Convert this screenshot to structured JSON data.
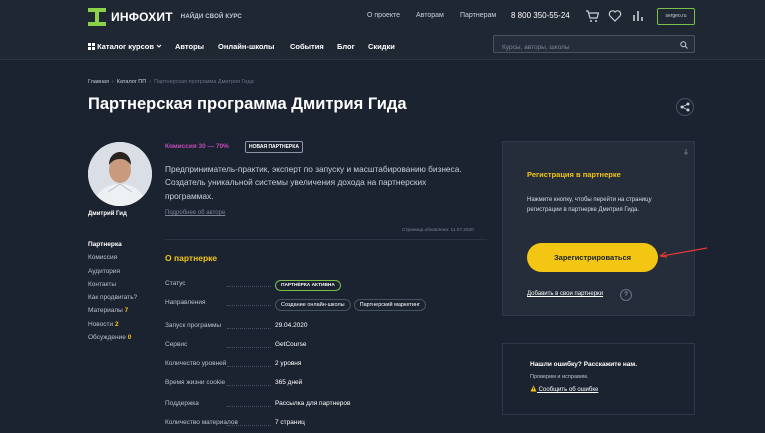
{
  "header": {
    "brand": "ИНФОХИТ",
    "tagline": "НАЙДИ СВОЙ КУРС",
    "links": [
      "О проекте",
      "Авторам",
      "Партнерам"
    ],
    "phone": "8 800 350-55-24",
    "account": "sergeo.ru"
  },
  "nav": {
    "catalog": "Каталог курсов",
    "items": [
      "Авторы",
      "Онлайн-школы",
      "События",
      "Блог",
      "Скидки"
    ],
    "search_placeholder": "Курсы, авторы, школы"
  },
  "breadcrumbs": [
    "Главная",
    "Каталог ПП",
    "Партнерская программа Дмитрия Гида"
  ],
  "page_title": "Партнерская программа Дмитрия Гида",
  "author": {
    "name": "Дмитрий Гид",
    "commission": "Комиссия 30 — 70%",
    "badge": "НОВАЯ ПАРТНЕРКА",
    "description": "Предприниматель-практик, эксперт по запуску и масштабированию бизнеса. Создатель уникальной системы увеличения дохода на партнерских программах.",
    "more_link": "Подробнее об авторе",
    "updated": "Страница обновлена: 11.07.2020"
  },
  "sidebar": {
    "items": [
      {
        "label": "Партнерка",
        "count": ""
      },
      {
        "label": "Комиссия",
        "count": ""
      },
      {
        "label": "Аудитория",
        "count": ""
      },
      {
        "label": "Контакты",
        "count": ""
      },
      {
        "label": "Как продвигать?",
        "count": ""
      },
      {
        "label": "Материалы",
        "count": "7"
      },
      {
        "label": "Новости",
        "count": "2"
      },
      {
        "label": "Обсуждение",
        "count": "0"
      }
    ]
  },
  "about": {
    "title": "О партнерке",
    "rows": [
      {
        "key": "Статус",
        "value": "ПАРТНЁРКА АКТИВНА"
      },
      {
        "key": "Направления",
        "value": ""
      },
      {
        "key": "Запуск программы",
        "value": "29.04.2020"
      },
      {
        "key": "Сервис",
        "value": "GetCourse"
      },
      {
        "key": "Количество уровней",
        "value": "2 уровня"
      },
      {
        "key": "Время жизни cookie",
        "value": "365 дней"
      },
      {
        "key": "Поддержка",
        "value": "Рассылка для партнеров"
      },
      {
        "key": "Количество материалов",
        "value": "7 страниц"
      }
    ],
    "tags": [
      "Создание онлайн-школы",
      "Партнерский маркетинг"
    ]
  },
  "register_card": {
    "title": "Регистрация в партнерке",
    "text": "Нажмите кнопку, чтобы перейти на страницу регистрации в партнерке Дмитрия Гида.",
    "button": "Зарегистрироваться",
    "add_link": "Добавить в свои партнерки",
    "help": "?"
  },
  "error_card": {
    "title": "Нашли ошибку? Расскажите нам.",
    "subtitle": "Проверим и исправим.",
    "link": "Сообщить об ошибке"
  },
  "colors": {
    "accent": "#f3c613",
    "brand": "#8bd24a",
    "commission": "#c54ab8",
    "bg": "#1b2230",
    "annotation": "#e53935"
  }
}
